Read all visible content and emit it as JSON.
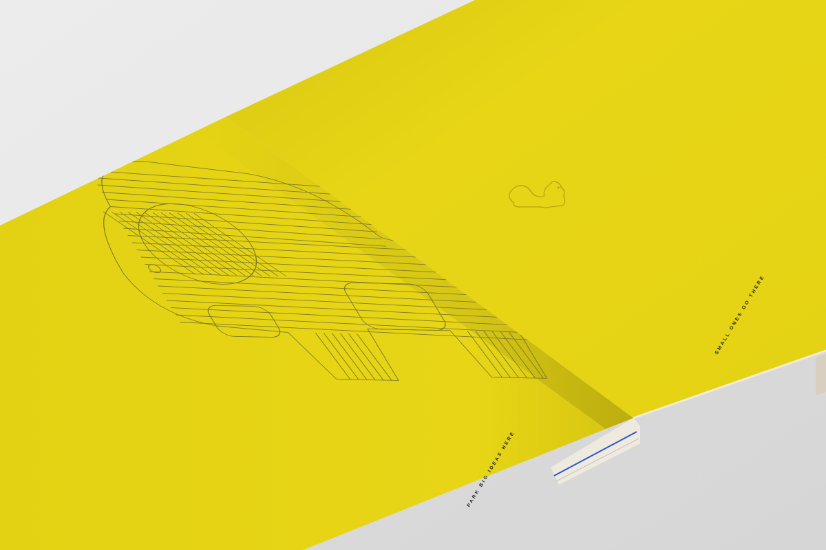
{
  "photo": {
    "subject": "open yellow notebook",
    "colors": {
      "background": "#e9e9e9",
      "page_yellow": "#e6d414",
      "page_yellow_shadow": "#cdbc10",
      "line_art": "#7d7a2a",
      "page_edges": "#f4f1ea",
      "edge_blue": "#2f55c8",
      "caption": "#1f1f12"
    }
  },
  "left_page": {
    "illustration": "elephant-line-art",
    "caption": "PARK BIG IDEAS HERE"
  },
  "right_page": {
    "illustration": "squirrel-outline",
    "caption": "SMALL ONES GO THERE"
  }
}
